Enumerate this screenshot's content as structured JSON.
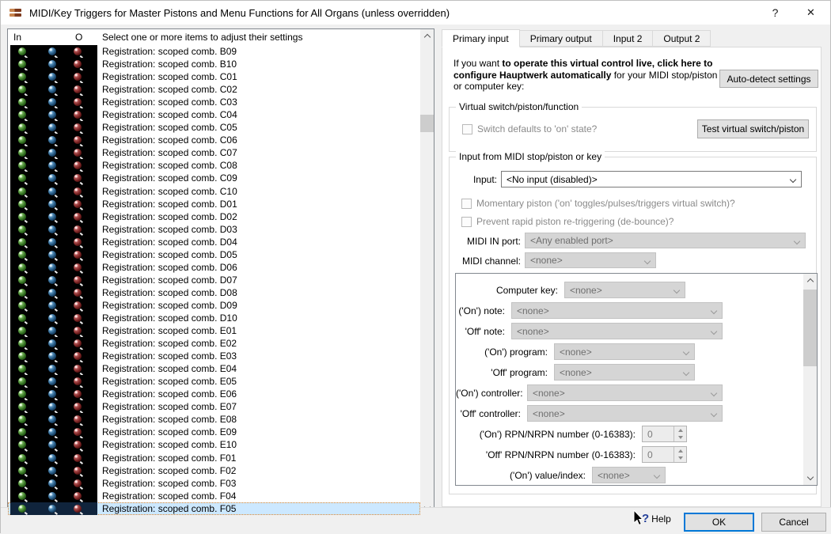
{
  "window": {
    "title": "MIDI/Key Triggers for Master Pistons and Menu Functions for All Organs (unless overridden)",
    "help_glyph": "?",
    "close_glyph": "✕"
  },
  "list": {
    "header": {
      "col_in": "In",
      "col_mid": "",
      "col_out": "O",
      "col_label": "Select one or more items to adjust their settings"
    },
    "items": [
      "Registration: scoped comb. B09",
      "Registration: scoped comb. B10",
      "Registration: scoped comb. C01",
      "Registration: scoped comb. C02",
      "Registration: scoped comb. C03",
      "Registration: scoped comb. C04",
      "Registration: scoped comb. C05",
      "Registration: scoped comb. C06",
      "Registration: scoped comb. C07",
      "Registration: scoped comb. C08",
      "Registration: scoped comb. C09",
      "Registration: scoped comb. C10",
      "Registration: scoped comb. D01",
      "Registration: scoped comb. D02",
      "Registration: scoped comb. D03",
      "Registration: scoped comb. D04",
      "Registration: scoped comb. D05",
      "Registration: scoped comb. D06",
      "Registration: scoped comb. D07",
      "Registration: scoped comb. D08",
      "Registration: scoped comb. D09",
      "Registration: scoped comb. D10",
      "Registration: scoped comb. E01",
      "Registration: scoped comb. E02",
      "Registration: scoped comb. E03",
      "Registration: scoped comb. E04",
      "Registration: scoped comb. E05",
      "Registration: scoped comb. E06",
      "Registration: scoped comb. E07",
      "Registration: scoped comb. E08",
      "Registration: scoped comb. E09",
      "Registration: scoped comb. E10",
      "Registration: scoped comb. F01",
      "Registration: scoped comb. F02",
      "Registration: scoped comb. F03",
      "Registration: scoped comb. F04",
      "Registration: scoped comb. F05"
    ],
    "selected_index": 36,
    "led_colors": {
      "in": "#2e6b1e",
      "mid": "#1d4d75",
      "out": "#6e1c1c"
    }
  },
  "tabs": [
    {
      "label": "Primary input",
      "active": true
    },
    {
      "label": "Primary output",
      "active": false
    },
    {
      "label": "Input 2",
      "active": false
    },
    {
      "label": "Output 2",
      "active": false
    }
  ],
  "primary_input": {
    "intro": {
      "pre": "If you want ",
      "bold": "to operate this virtual control live, click here to configure Hauptwerk automatically",
      "post": " for your MIDI stop/piston or computer key:"
    },
    "auto_detect_button": "Auto-detect settings",
    "virtual_switch_group": {
      "title": "Virtual switch/piston/function",
      "switch_default_checkbox": "Switch defaults to 'on' state?",
      "test_button": "Test virtual switch/piston"
    },
    "input_group": {
      "title": "Input from MIDI stop/piston or key",
      "input_label": "Input:",
      "input_value": "<No input (disabled)>",
      "momentary_checkbox": "Momentary piston ('on' toggles/pulses/triggers virtual switch)?",
      "debounce_checkbox": "Prevent rapid piston re-triggering (de-bounce)?",
      "midi_in_port_label": "MIDI IN port:",
      "midi_in_port_value": "<Any enabled port>",
      "midi_channel_label": "MIDI channel:",
      "midi_channel_value": "<none>",
      "detail_rows": [
        {
          "label": "Computer key:",
          "value": "<none>",
          "kind": "combo",
          "size": "ck"
        },
        {
          "label": "('On') note:",
          "value": "<none>",
          "kind": "combo",
          "size": "wide"
        },
        {
          "label": "'Off' note:",
          "value": "<none>",
          "kind": "combo",
          "size": "wide"
        },
        {
          "label": "('On') program:",
          "value": "<none>",
          "kind": "combo",
          "size": "med"
        },
        {
          "label": "'Off' program:",
          "value": "<none>",
          "kind": "combo",
          "size": "med"
        },
        {
          "label": "('On') controller:",
          "value": "<none>",
          "kind": "combo",
          "size": "wide2"
        },
        {
          "label": "'Off' controller:",
          "value": "<none>",
          "kind": "combo",
          "size": "wide2"
        },
        {
          "label": "('On') RPN/NRPN number (0-16383):",
          "value": "0",
          "kind": "spin",
          "size": "spin"
        },
        {
          "label": "'Off' RPN/NRPN number (0-16383):",
          "value": "0",
          "kind": "spin",
          "size": "spin"
        },
        {
          "label": "('On') value/index:",
          "value": "<none>",
          "kind": "combo",
          "size": "small"
        }
      ]
    }
  },
  "footer": {
    "help_label": "Help",
    "ok_label": "OK",
    "cancel_label": "Cancel"
  }
}
